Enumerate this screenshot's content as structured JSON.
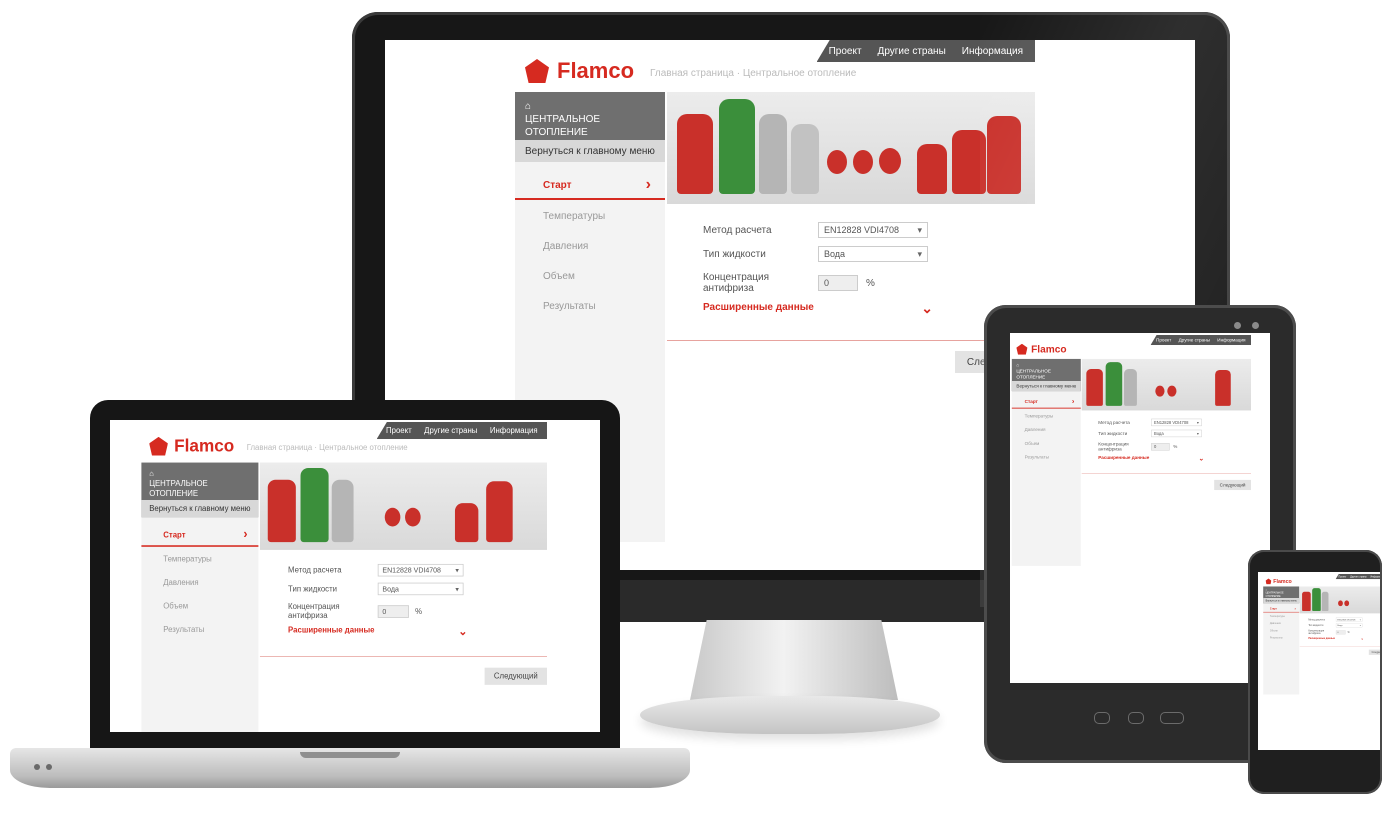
{
  "brand": {
    "name": "Flamco",
    "accent": "#d62a20"
  },
  "app": {
    "top_nav": [
      "Проект",
      "Другие страны",
      "Информация"
    ],
    "breadcrumb": "Главная страница · Центральное отопление",
    "sidebar": {
      "heading_icon": "home-icon",
      "heading": "ЦЕНТРАЛЬНОЕ ОТОПЛЕНИЕ",
      "back_link": "Вернуться к главному меню",
      "items": [
        {
          "label": "Старт",
          "active": true
        },
        {
          "label": "Температуры",
          "active": false
        },
        {
          "label": "Давления",
          "active": false
        },
        {
          "label": "Объем",
          "active": false
        },
        {
          "label": "Результаты",
          "active": false
        }
      ]
    },
    "form": {
      "method_label": "Метод расчета",
      "method_value": "EN12828 VDI4708",
      "fluid_label": "Тип жидкости",
      "fluid_value": "Вода",
      "antifreeze_label": "Концентрация антифриза",
      "antifreeze_value": "0",
      "antifreeze_unit": "%",
      "advanced_label": "Расширенные данные"
    },
    "next_button": "Следующий"
  },
  "devices": [
    "monitor",
    "laptop",
    "tablet",
    "phone"
  ]
}
